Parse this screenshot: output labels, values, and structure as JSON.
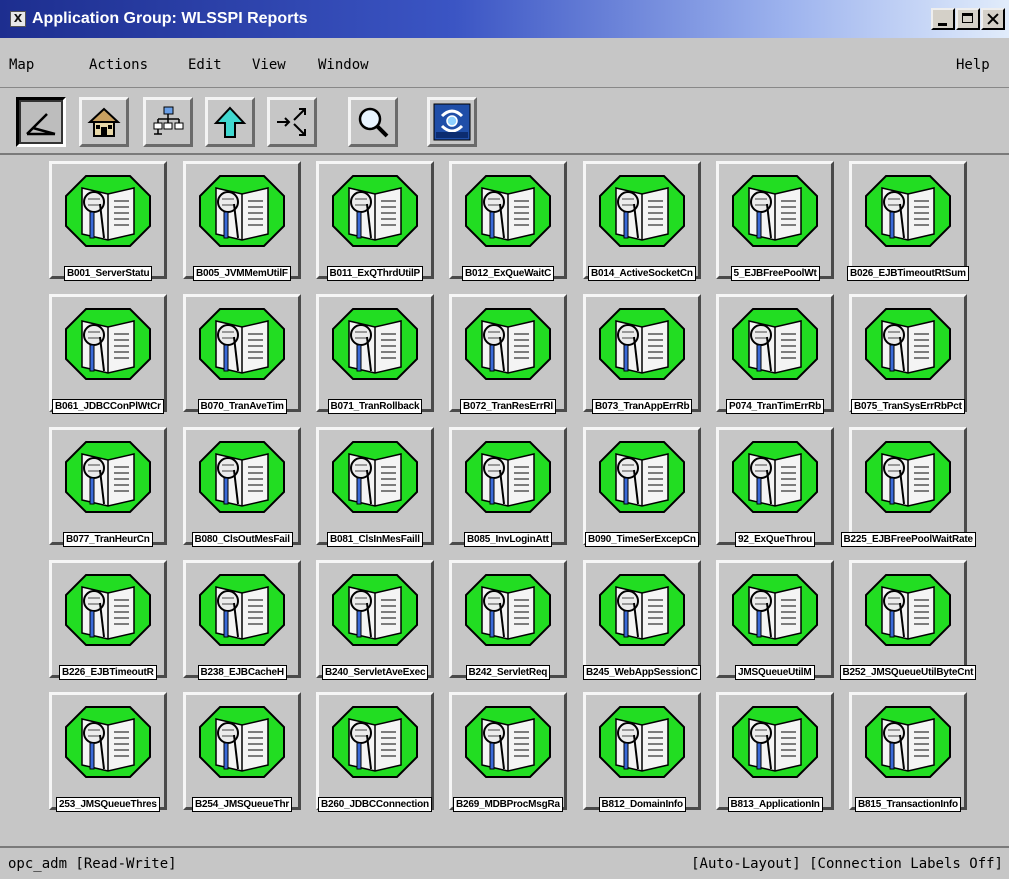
{
  "window": {
    "title": "Application Group: WLSSPI Reports",
    "title_icon_glyph": "X"
  },
  "menubar": {
    "left": [
      "Map",
      "Actions",
      "Edit",
      "View",
      "Window"
    ],
    "help": "Help"
  },
  "toolbar": {
    "buttons": [
      {
        "icon": "close-view-icon",
        "active": true
      },
      {
        "icon": "home-icon",
        "active": false
      },
      {
        "icon": "tree-icon",
        "active": false
      },
      {
        "icon": "up-arrow-icon",
        "active": false
      },
      {
        "icon": "pan-icon",
        "active": false
      },
      {
        "icon": "magnifier-icon",
        "active": false
      },
      {
        "icon": "hp-openview-icon",
        "active": false,
        "label": "HP OpenView"
      }
    ]
  },
  "symbols": {
    "rows": [
      [
        "B001_ServerStatu",
        "B005_JVMMemUtilF",
        "B011_ExQThrdUtilP",
        "B012_ExQueWaitC",
        "B014_ActiveSocketCn",
        "5_EJBFreePoolWt",
        "B026_EJBTimeoutRtSum"
      ],
      [
        "B061_JDBCConPlWtCr",
        "B070_TranAveTim",
        "B071_TranRollback",
        "B072_TranResErrRl",
        "B073_TranAppErrRb",
        "P074_TranTimErrRb",
        "B075_TranSysErrRbPct"
      ],
      [
        "B077_TranHeurCn",
        "B080_ClsOutMesFail",
        "B081_ClsInMesFaill",
        "B085_InvLoginAtt",
        "B090_TimeSerExcepCn",
        "92_ExQueThrou",
        "B225_EJBFreePoolWaitRate"
      ],
      [
        "B226_EJBTimeoutR",
        "B238_EJBCacheH",
        "B240_ServletAveExec",
        "B242_ServletReq",
        "B245_WebAppSessionC",
        "JMSQueueUtilM",
        "B252_JMSQueueUtilByteCnt"
      ],
      [
        "253_JMSQueueThres",
        "B254_JMSQueueThr",
        "B260_JDBCConnection",
        "B269_MDBProcMsgRa",
        "B812_DomainInfo",
        "B813_ApplicationIn",
        "B815_TransactionInfo"
      ]
    ],
    "icon": "report-book-icon",
    "background_color": "#22dd22"
  },
  "statusbar": {
    "left": "opc_adm [Read-Write]",
    "right": "[Auto-Layout] [Connection Labels Off]"
  }
}
